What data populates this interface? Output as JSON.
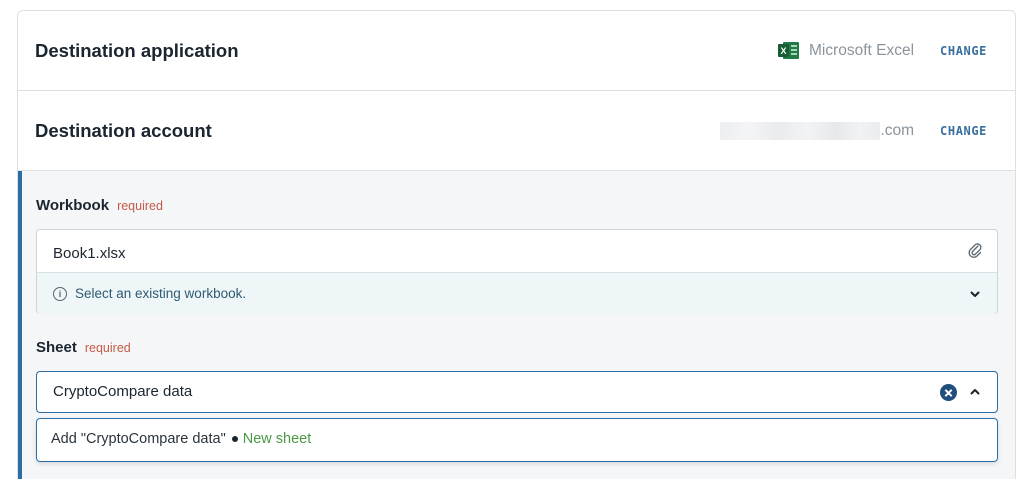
{
  "destination_application": {
    "title": "Destination application",
    "app_icon": "microsoft-excel-icon",
    "app_icon_letter": "X",
    "app_name": "Microsoft Excel",
    "change_label": "CHANGE"
  },
  "destination_account": {
    "title": "Destination account",
    "email_visible_suffix": ".com",
    "change_label": "CHANGE"
  },
  "workbook": {
    "label": "Workbook",
    "required_label": "required",
    "value": "Book1.xlsx",
    "hint_icon": "info-icon",
    "hint_icon_glyph": "i",
    "hint": "Select an existing workbook."
  },
  "sheet": {
    "label": "Sheet",
    "required_label": "required",
    "value": "CryptoCompare data",
    "option_add": "Add \"CryptoCompare data\"",
    "option_new": "New sheet"
  },
  "colors": {
    "accent": "#2c6ea3",
    "required": "#c65a4a",
    "new_sheet": "#4a9a45",
    "excel_green": "#1f7a45"
  }
}
